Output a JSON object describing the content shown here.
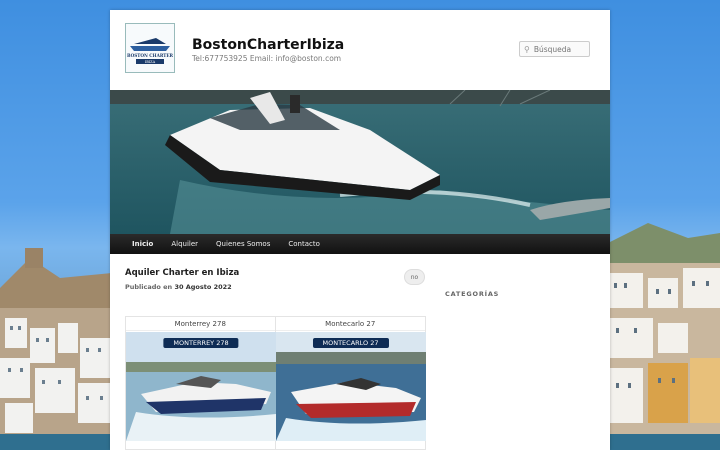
{
  "site": {
    "title": "BostonCharterIbiza",
    "description": "Tel:677753925 Email: info@boston.com",
    "logo_text_top": "BOSTON CHARTER",
    "logo_text_bottom": "IBIZA"
  },
  "search": {
    "placeholder": "Búsqueda"
  },
  "nav": {
    "items": [
      "Inicio",
      "Alquiler",
      "Quienes Somos",
      "Contacto"
    ]
  },
  "post": {
    "title": "Aquiler Charter en Ibiza",
    "meta_prefix": "Publicado en",
    "date": "30 Agosto 2022",
    "comments": "no"
  },
  "sidebar": {
    "heading": "CATEGORÍAS"
  },
  "boats": [
    {
      "name": "Monterrey 278",
      "tag": "MONTERREY 278"
    },
    {
      "name": "Montecarlo 27",
      "tag": "MONTECARLO 27"
    }
  ],
  "colors": {
    "nav_bg": "#1b1b1b",
    "tag_bg": "#0e2c55",
    "sky": "#4a96e4"
  }
}
